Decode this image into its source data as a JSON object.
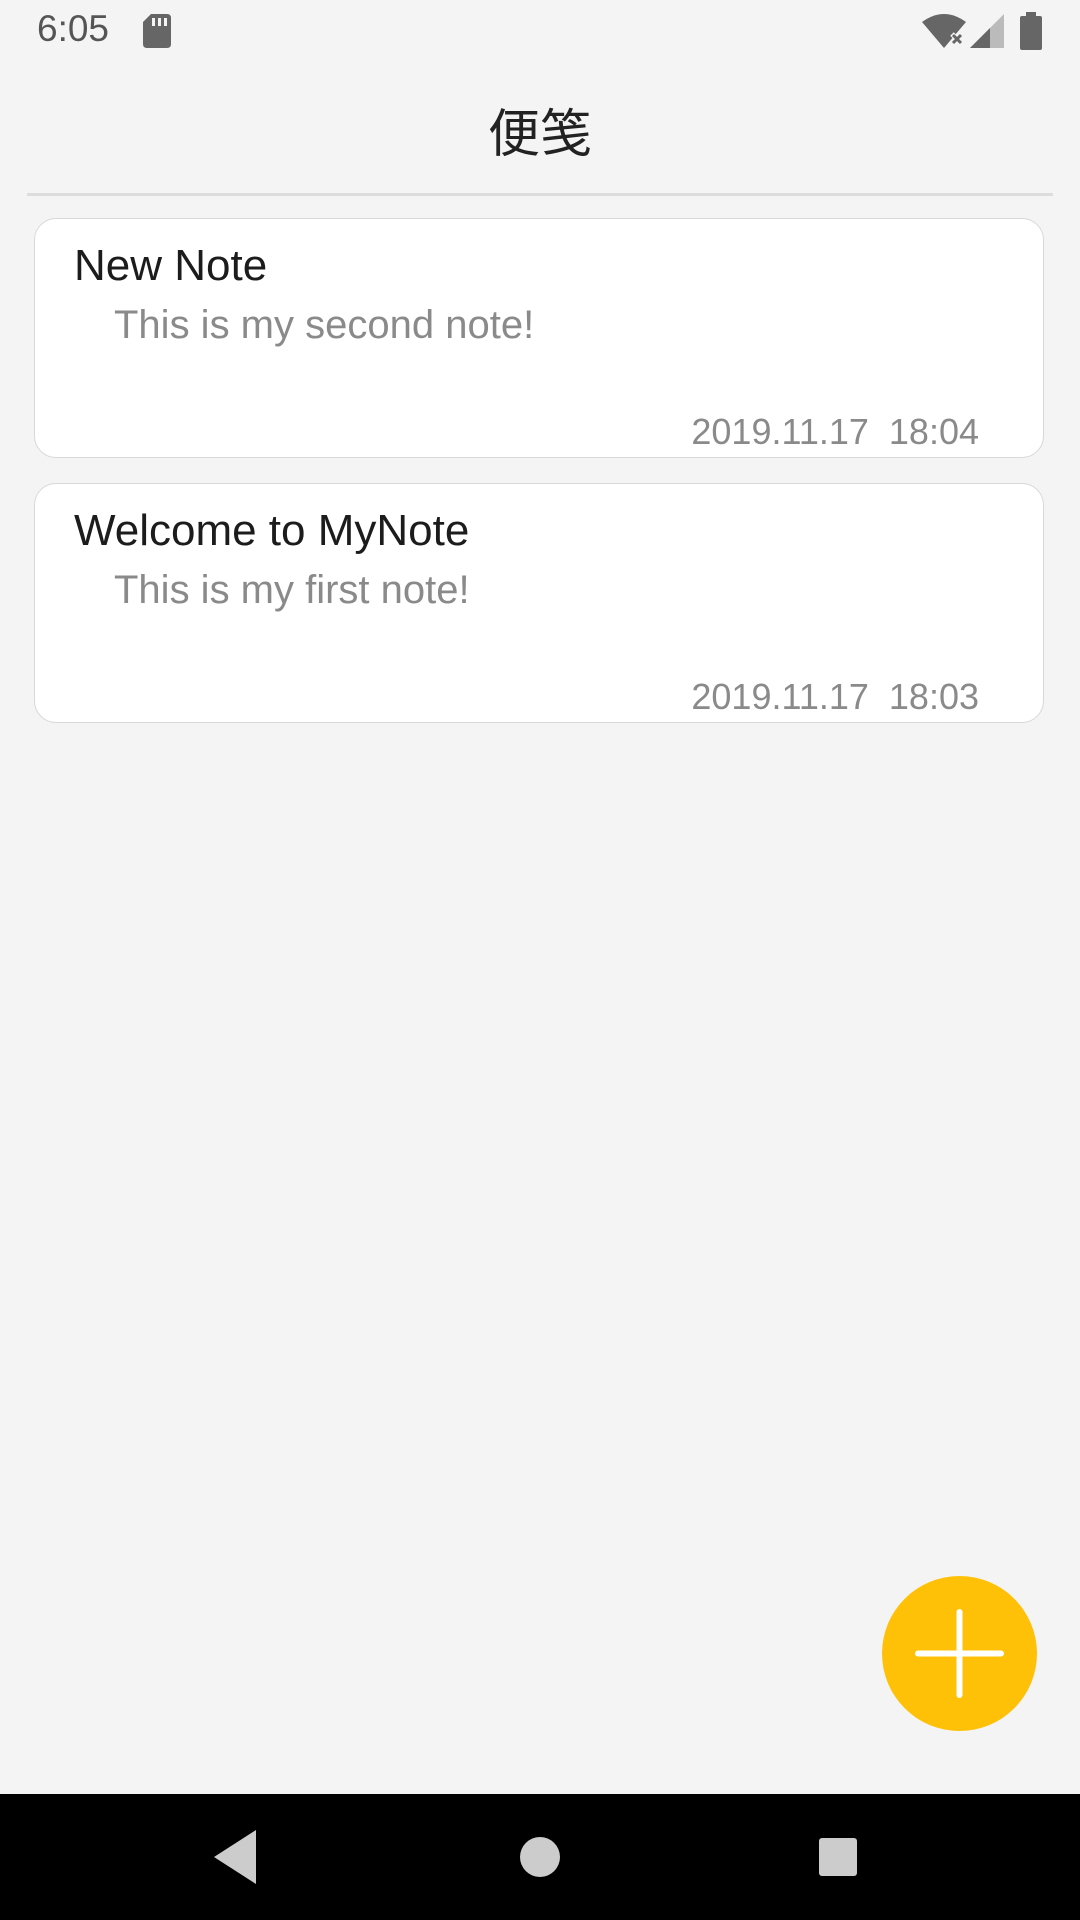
{
  "status_bar": {
    "time": "6:05",
    "icons": [
      "sd-card-icon",
      "wifi-icon",
      "signal-icon",
      "battery-icon"
    ]
  },
  "app_bar": {
    "title": "便笺"
  },
  "notes": [
    {
      "title": "New Note",
      "body": "This is my second note!",
      "date": "2019.11.17  18:04"
    },
    {
      "title": "Welcome to MyNote",
      "body": "This is my first note!",
      "date": "2019.11.17  18:03"
    }
  ],
  "fab": {
    "icon": "plus-icon",
    "color": "#ffc107"
  },
  "nav_bar": {
    "buttons": [
      "back-icon",
      "home-icon",
      "recents-icon"
    ]
  }
}
